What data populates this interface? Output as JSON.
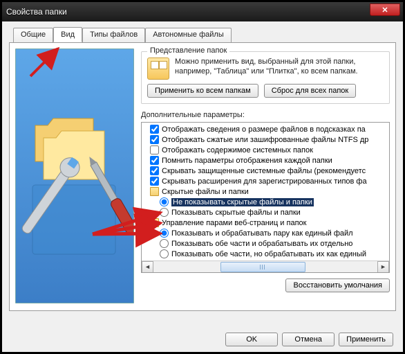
{
  "window": {
    "title": "Свойства папки"
  },
  "tabs": {
    "general": "Общие",
    "view": "Вид",
    "filetypes": "Типы файлов",
    "offline": "Автономные файлы"
  },
  "group_views": {
    "legend": "Представление папок",
    "desc": "Можно применить вид, выбранный для этой папки, например, \"Таблица\" или \"Плитка\", ко всем папкам.",
    "apply_all": "Применить ко всем папкам",
    "reset_all": "Сброс для всех папок"
  },
  "advanced_label": "Дополнительные параметры:",
  "tree": {
    "cb_size_tips": "Отображать сведения о размере файлов в подсказках па",
    "cb_compressed": "Отображать сжатые или зашифрованные файлы NTFS др",
    "cb_contents": "Отображать содержимое системных папок",
    "cb_remember": "Помнить параметры отображения каждой папки",
    "cb_hide_protected": "Скрывать защищенные системные файлы (рекомендуетс",
    "cb_hide_ext": "Скрывать расширения для зарегистрированных типов фа",
    "group_hidden": "Скрытые файлы и папки",
    "rb_hide": "Не показывать скрытые файлы и папки",
    "rb_show": "Показывать скрытые файлы и папки",
    "group_pairs": "Управление парами веб-страниц и папок",
    "rb_pair_single": "Показывать и обрабатывать пару как единый файл",
    "rb_pair_both": "Показывать обе части и обрабатывать их отдельно",
    "rb_pair_both2": "Показывать обе части, но обрабатывать их как единый"
  },
  "restore_defaults": "Восстановить умолчания",
  "buttons": {
    "ok": "OK",
    "cancel": "Отмена",
    "apply": "Применить"
  },
  "close_glyph": "✕"
}
